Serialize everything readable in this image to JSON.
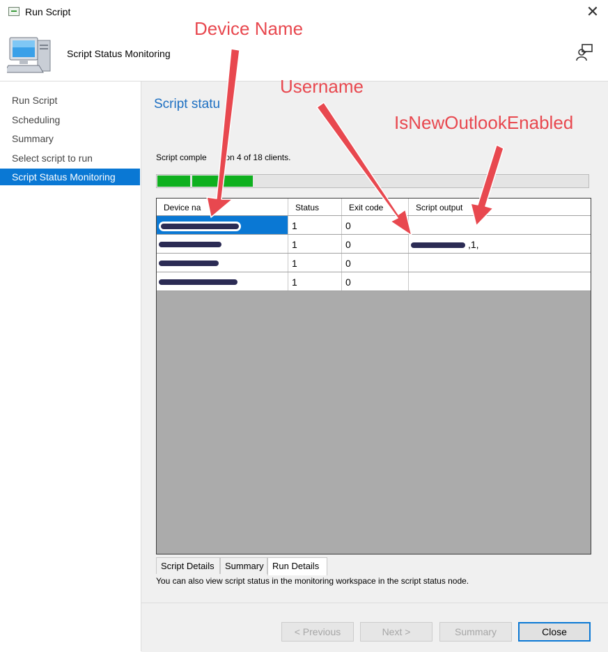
{
  "window": {
    "title": "Run Script",
    "close_glyph": "✕"
  },
  "header": {
    "title": "Script Status Monitoring",
    "icon": "computer-icon",
    "help_icon": "user-feedback-icon"
  },
  "nav": {
    "items": [
      {
        "label": "Run Script",
        "active": false
      },
      {
        "label": "Scheduling",
        "active": false
      },
      {
        "label": "Summary",
        "active": false
      },
      {
        "label": "Select script to run",
        "active": false
      },
      {
        "label": "Script Status Monitoring",
        "active": true
      }
    ]
  },
  "main": {
    "section_title": "Script statu",
    "summary_text": "Script comple        on 4 of 18 clients.",
    "progress": {
      "completed": 4,
      "total": 18,
      "fraction": 0.222
    },
    "grid": {
      "columns": [
        "Device na      ",
        "Status",
        "Exit code",
        "Script output"
      ],
      "rows": [
        {
          "device": "[redacted]",
          "status": "1",
          "exit_code": "0",
          "output": "",
          "output_redacted": false
        },
        {
          "device": "[redacted]",
          "status": "1",
          "exit_code": "0",
          "output": ",1,",
          "output_redacted": true
        },
        {
          "device": "[redacted]",
          "status": "1",
          "exit_code": "0",
          "output": "",
          "output_redacted": false
        },
        {
          "device": "[redacted]",
          "status": "1",
          "exit_code": "0",
          "output": "",
          "output_redacted": false
        }
      ]
    },
    "tabs": [
      {
        "label": "Script Details",
        "active": false
      },
      {
        "label": "Summary",
        "active": false
      },
      {
        "label": "Run Details",
        "active": true
      }
    ],
    "hint": "You can also view script status in the monitoring workspace in the script status node."
  },
  "footer": {
    "previous": "< Previous",
    "next": "Next >",
    "summary": "Summary",
    "close": "Close"
  },
  "annotations": {
    "device_name": "Device Name",
    "username": "Username",
    "outlook": "IsNewOutlookEnabled",
    "color": "#e8484f"
  },
  "colors": {
    "accent": "#0a78d4",
    "progress": "#0fb01f",
    "title_blue": "#1c6fc2",
    "redaction": "#2b2b54"
  }
}
